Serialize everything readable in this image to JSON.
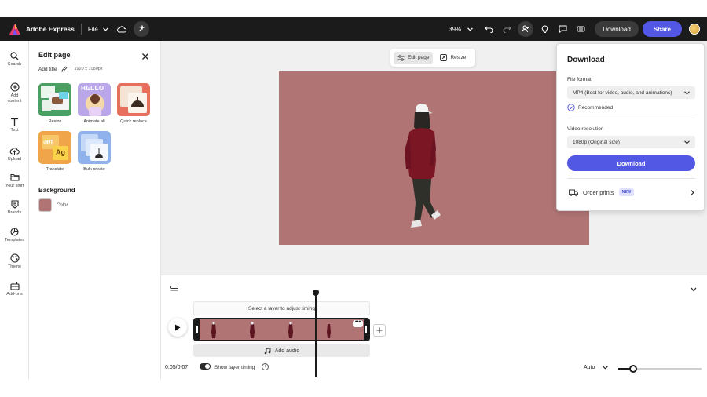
{
  "topbar": {
    "brand": "Adobe Express",
    "file_menu": "File",
    "zoom": "39%",
    "download_label": "Download",
    "share_label": "Share"
  },
  "rail": {
    "items": [
      {
        "label": "Search",
        "icon": "search-icon"
      },
      {
        "label": "Add content",
        "icon": "plus-circle-icon"
      },
      {
        "label": "Text",
        "icon": "text-icon"
      },
      {
        "label": "Upload",
        "icon": "upload-icon"
      },
      {
        "label": "Your stuff",
        "icon": "folder-icon"
      },
      {
        "label": "Brands",
        "icon": "brand-icon"
      },
      {
        "label": "Templates",
        "icon": "templates-icon"
      },
      {
        "label": "Theme",
        "icon": "theme-icon"
      },
      {
        "label": "Add-ons",
        "icon": "addons-icon"
      }
    ]
  },
  "panel": {
    "title": "Edit page",
    "add_title": "Add title",
    "dimensions": "1920 x 1080px",
    "tools": [
      {
        "label": "Resize",
        "tile_text": ""
      },
      {
        "label": "Animate all",
        "tile_text": "HELLO"
      },
      {
        "label": "Quick replace",
        "tile_text": ""
      },
      {
        "label": "Translate",
        "tile_text": "अग"
      },
      {
        "label": "Bulk create",
        "tile_text": ""
      }
    ],
    "translate_tile_text_2": "Ag",
    "background_label": "Background",
    "color_label": "Color",
    "background_color": "#b07474"
  },
  "canvas": {
    "edit_page_label": "Edit page",
    "resize_label": "Resize",
    "artboard_color": "#b07474"
  },
  "download_popover": {
    "title": "Download",
    "file_format_label": "File format",
    "file_format_value": "MP4 (Best for video, audio, and animations)",
    "recommended_label": "Recommended",
    "resolution_label": "Video resolution",
    "resolution_value": "1080p (Original size)",
    "download_button": "Download",
    "order_prints_label": "Order prints",
    "new_badge": "NEW"
  },
  "timeline": {
    "hint": "Select a layer to adjust timing",
    "add_audio": "Add audio",
    "time": "0:05/0:07",
    "show_layer_timing": "Show layer timing",
    "zoom_mode": "Auto",
    "zoom_level": 0.18
  },
  "colors": {
    "accent": "#5258e4",
    "topbar": "#1b1b1b",
    "artboard": "#b07474"
  }
}
